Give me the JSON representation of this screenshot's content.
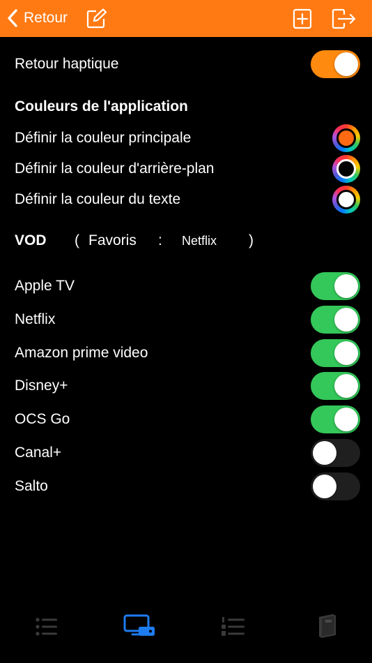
{
  "colors": {
    "accent": "#ff7a13",
    "toggle_on_green": "#34c759",
    "toggle_off": "#1f1f1f",
    "tab_active": "#1e7cf0",
    "tab_inactive": "#3a3a3a"
  },
  "navbar": {
    "back_label": "Retour",
    "icons": [
      "chevron-left-icon",
      "edit-icon",
      "add-square-icon",
      "logout-icon"
    ]
  },
  "haptic": {
    "label": "Retour haptique",
    "on": true
  },
  "colors_section": {
    "title": "Couleurs de l'application",
    "items": [
      {
        "label": "Définir la couleur principale",
        "swatch": "#ff6a13"
      },
      {
        "label": "Définir la couleur d'arrière-plan",
        "swatch": "#000000"
      },
      {
        "label": "Définir la couleur du texte",
        "swatch": "#ffffff"
      }
    ]
  },
  "vod": {
    "title": "VOD",
    "open_paren": "(",
    "favorites_label": "Favoris",
    "colon": ":",
    "favorites_value": "Netflix",
    "close_paren": ")"
  },
  "services": [
    {
      "label": "Apple TV",
      "on": true
    },
    {
      "label": "Netflix",
      "on": true
    },
    {
      "label": "Amazon prime video",
      "on": true
    },
    {
      "label": "Disney+",
      "on": true
    },
    {
      "label": "OCS Go",
      "on": true
    },
    {
      "label": "Canal+",
      "on": false
    },
    {
      "label": "Salto",
      "on": false
    }
  ],
  "tabbar": {
    "tabs": [
      {
        "icon": "list-icon",
        "active": false
      },
      {
        "icon": "tv-remote-icon",
        "active": true
      },
      {
        "icon": "numbered-list-icon",
        "active": false
      },
      {
        "icon": "book-icon",
        "active": false
      }
    ]
  }
}
